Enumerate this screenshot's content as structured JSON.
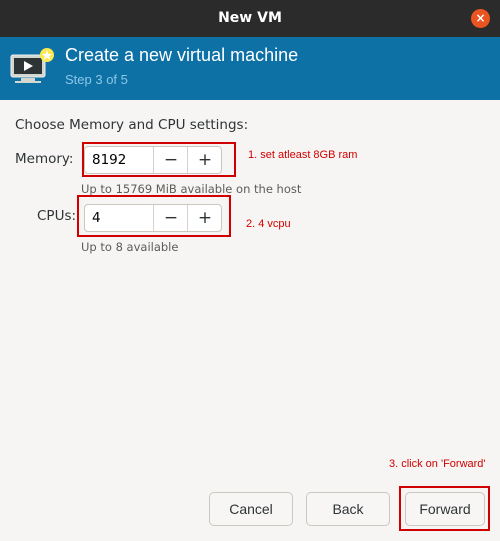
{
  "window": {
    "title": "New VM",
    "close_glyph": "×"
  },
  "header": {
    "title": "Create a new virtual machine",
    "step": "Step 3 of 5",
    "icon": "vm-monitor-icon"
  },
  "section_label": "Choose Memory and CPU settings:",
  "memory": {
    "label": "Memory:",
    "value": "8192",
    "minus": "−",
    "plus": "+",
    "hint": "Up to 15769 MiB available on the host"
  },
  "cpus": {
    "label": "CPUs:",
    "value": "4",
    "minus": "−",
    "plus": "+",
    "hint": "Up to 8 available"
  },
  "annotations": {
    "memory": "1. set atleast 8GB ram",
    "cpus": "2. 4 vcpu",
    "forward": "3. click on 'Forward'"
  },
  "buttons": {
    "cancel": "Cancel",
    "back": "Back",
    "forward": "Forward"
  },
  "colors": {
    "titlebar": "#2b2b2b",
    "header": "#0d71a6",
    "close": "#e95420",
    "annotation": "#d00000"
  }
}
